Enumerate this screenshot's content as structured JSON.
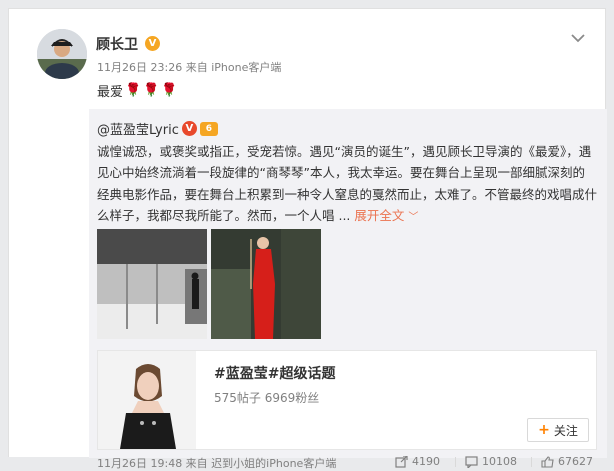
{
  "post": {
    "username": "顾长卫",
    "verified_badge": "V",
    "timestamp": "11月26日 23:26",
    "source_prefix": "来自",
    "source": "iPhone客户端",
    "text": "最爱",
    "emoji": [
      "rose-icon",
      "rose-icon",
      "rose-icon"
    ]
  },
  "repost": {
    "author": "@蓝盈莹Lyric",
    "verified_badge": "V",
    "vip_badge": "6",
    "text": "诚惶诚恐，或褒奖或指正，受宠若惊。遇见“演员的诞生”，遇见顾长卫导演的《最爱》，遇见心中始终流淌着一段旋律的“商琴琴”本人，我太幸运。要在舞台上呈现一部细腻深刻的经典电影作品，要在舞台上积累到一种令人窒息的戛然而止，太难了。不管最终的戏唱成什么样子，我都尽我所能了。然而，一个人唱 ...",
    "expand_label": "展开全文",
    "topic": {
      "title": "#蓝盈莹#超级话题",
      "stats": "575帖子 6969粉丝",
      "follow_label": "关注"
    },
    "meta": "11月26日 19:48 来自 迟到小姐的iPhone客户端",
    "actions": {
      "repost_count": "4190",
      "comment_count": "10108",
      "like_count": "67627"
    }
  },
  "colors": {
    "accent_orange": "#eb7350",
    "follow_plus": "#ff8200",
    "verified_gold": "#f5a623",
    "verified_red": "#e8492c"
  }
}
